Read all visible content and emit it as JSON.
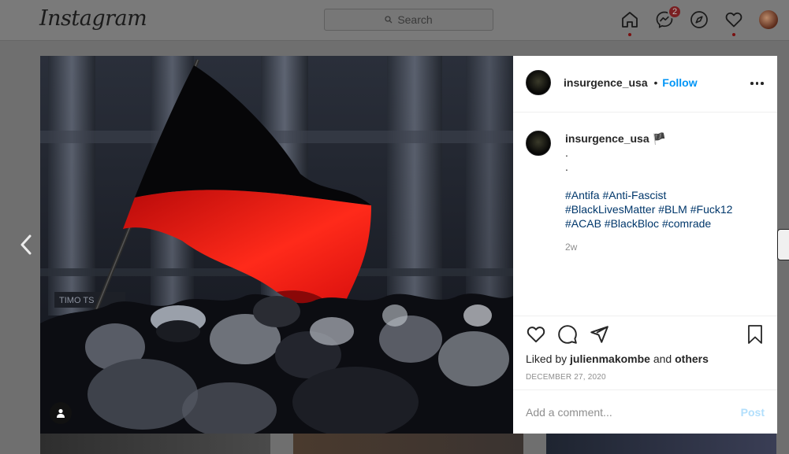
{
  "topbar": {
    "logo": "Instagram",
    "search_placeholder": "Search",
    "messages_badge": "2"
  },
  "post": {
    "author": "insurgence_usa",
    "follow_label": "Follow",
    "follow_separator": "•",
    "caption_author": "insurgence_usa",
    "caption_flag": "🏴",
    "caption_dots": [
      ".",
      "."
    ],
    "hashtag_lines": [
      "#Antifa #Anti-Fascist",
      "#BlackLivesMatter #BLM #Fuck12",
      "#ACAB #BlackBloc #comrade"
    ],
    "time_ago": "2w",
    "liked_by_prefix": "Liked by",
    "liked_by_user": "julienmakombe",
    "liked_by_middle": "and",
    "liked_by_suffix": "others",
    "date": "DECEMBER 27, 2020",
    "comment_placeholder": "Add a comment...",
    "post_button": "Post"
  },
  "photo": {
    "sign_text": "TIMO  TS"
  },
  "colors": {
    "accent": "#0095f6",
    "flag_red": "#e01010",
    "hashtag": "#00376b"
  }
}
